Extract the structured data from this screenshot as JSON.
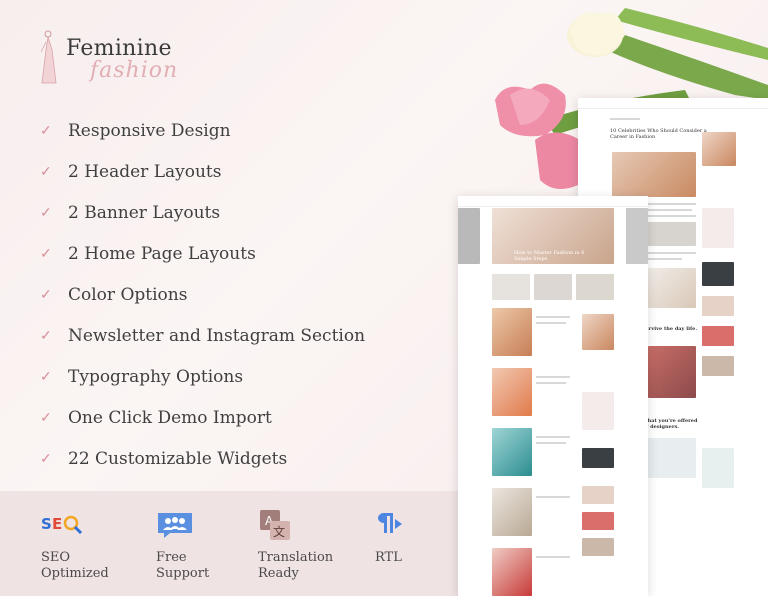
{
  "logo": {
    "brand": "Feminine",
    "script": "fashion"
  },
  "features": [
    "Responsive Design",
    "2 Header Layouts",
    "2 Banner Layouts",
    "2 Home Page Layouts",
    "Color Options",
    "Newsletter and Instagram Section",
    "Typography Options",
    "One Click Demo Import",
    "22 Customizable Widgets"
  ],
  "check_glyph": "✓",
  "bottom_features": [
    {
      "icon": "seo-icon",
      "line1": "SEO",
      "line2": "Optimized"
    },
    {
      "icon": "support-icon",
      "line1": "Free",
      "line2": "Support"
    },
    {
      "icon": "translation-icon",
      "line1": "Translation",
      "line2": "Ready"
    },
    {
      "icon": "rtl-icon",
      "line1": "RTL",
      "line2": ""
    }
  ],
  "mockup": {
    "post_title": "10 Celebrities Who Should Consider a Career in Fashion",
    "banner_title": "How to Master Fashion in 6 Simple Steps",
    "article_heading": "mer to survive the day life.",
    "article_heading2": "What you're offered by designers."
  },
  "colors": {
    "accent": "#d88f98",
    "bottom_band": "#efe3e3"
  }
}
